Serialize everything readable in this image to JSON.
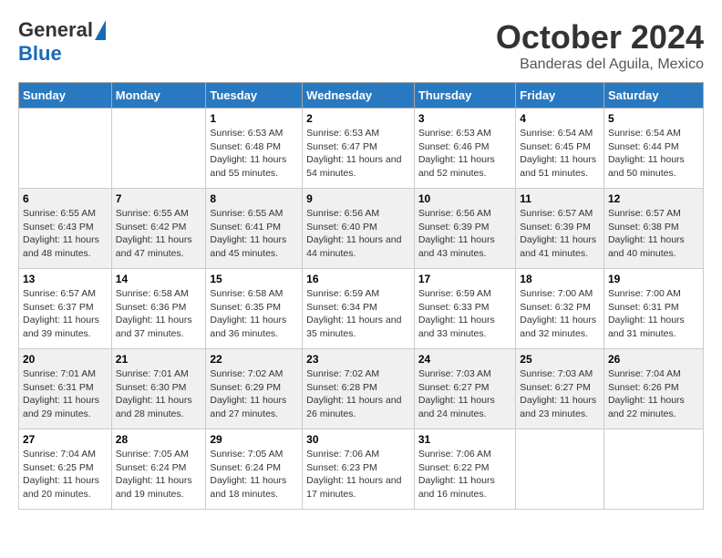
{
  "logo": {
    "general": "General",
    "blue": "Blue"
  },
  "title": "October 2024",
  "location": "Banderas del Aguila, Mexico",
  "days_header": [
    "Sunday",
    "Monday",
    "Tuesday",
    "Wednesday",
    "Thursday",
    "Friday",
    "Saturday"
  ],
  "weeks": [
    [
      {
        "day": "",
        "info": ""
      },
      {
        "day": "",
        "info": ""
      },
      {
        "day": "1",
        "info": "Sunrise: 6:53 AM\nSunset: 6:48 PM\nDaylight: 11 hours and 55 minutes."
      },
      {
        "day": "2",
        "info": "Sunrise: 6:53 AM\nSunset: 6:47 PM\nDaylight: 11 hours and 54 minutes."
      },
      {
        "day": "3",
        "info": "Sunrise: 6:53 AM\nSunset: 6:46 PM\nDaylight: 11 hours and 52 minutes."
      },
      {
        "day": "4",
        "info": "Sunrise: 6:54 AM\nSunset: 6:45 PM\nDaylight: 11 hours and 51 minutes."
      },
      {
        "day": "5",
        "info": "Sunrise: 6:54 AM\nSunset: 6:44 PM\nDaylight: 11 hours and 50 minutes."
      }
    ],
    [
      {
        "day": "6",
        "info": "Sunrise: 6:55 AM\nSunset: 6:43 PM\nDaylight: 11 hours and 48 minutes."
      },
      {
        "day": "7",
        "info": "Sunrise: 6:55 AM\nSunset: 6:42 PM\nDaylight: 11 hours and 47 minutes."
      },
      {
        "day": "8",
        "info": "Sunrise: 6:55 AM\nSunset: 6:41 PM\nDaylight: 11 hours and 45 minutes."
      },
      {
        "day": "9",
        "info": "Sunrise: 6:56 AM\nSunset: 6:40 PM\nDaylight: 11 hours and 44 minutes."
      },
      {
        "day": "10",
        "info": "Sunrise: 6:56 AM\nSunset: 6:39 PM\nDaylight: 11 hours and 43 minutes."
      },
      {
        "day": "11",
        "info": "Sunrise: 6:57 AM\nSunset: 6:39 PM\nDaylight: 11 hours and 41 minutes."
      },
      {
        "day": "12",
        "info": "Sunrise: 6:57 AM\nSunset: 6:38 PM\nDaylight: 11 hours and 40 minutes."
      }
    ],
    [
      {
        "day": "13",
        "info": "Sunrise: 6:57 AM\nSunset: 6:37 PM\nDaylight: 11 hours and 39 minutes."
      },
      {
        "day": "14",
        "info": "Sunrise: 6:58 AM\nSunset: 6:36 PM\nDaylight: 11 hours and 37 minutes."
      },
      {
        "day": "15",
        "info": "Sunrise: 6:58 AM\nSunset: 6:35 PM\nDaylight: 11 hours and 36 minutes."
      },
      {
        "day": "16",
        "info": "Sunrise: 6:59 AM\nSunset: 6:34 PM\nDaylight: 11 hours and 35 minutes."
      },
      {
        "day": "17",
        "info": "Sunrise: 6:59 AM\nSunset: 6:33 PM\nDaylight: 11 hours and 33 minutes."
      },
      {
        "day": "18",
        "info": "Sunrise: 7:00 AM\nSunset: 6:32 PM\nDaylight: 11 hours and 32 minutes."
      },
      {
        "day": "19",
        "info": "Sunrise: 7:00 AM\nSunset: 6:31 PM\nDaylight: 11 hours and 31 minutes."
      }
    ],
    [
      {
        "day": "20",
        "info": "Sunrise: 7:01 AM\nSunset: 6:31 PM\nDaylight: 11 hours and 29 minutes."
      },
      {
        "day": "21",
        "info": "Sunrise: 7:01 AM\nSunset: 6:30 PM\nDaylight: 11 hours and 28 minutes."
      },
      {
        "day": "22",
        "info": "Sunrise: 7:02 AM\nSunset: 6:29 PM\nDaylight: 11 hours and 27 minutes."
      },
      {
        "day": "23",
        "info": "Sunrise: 7:02 AM\nSunset: 6:28 PM\nDaylight: 11 hours and 26 minutes."
      },
      {
        "day": "24",
        "info": "Sunrise: 7:03 AM\nSunset: 6:27 PM\nDaylight: 11 hours and 24 minutes."
      },
      {
        "day": "25",
        "info": "Sunrise: 7:03 AM\nSunset: 6:27 PM\nDaylight: 11 hours and 23 minutes."
      },
      {
        "day": "26",
        "info": "Sunrise: 7:04 AM\nSunset: 6:26 PM\nDaylight: 11 hours and 22 minutes."
      }
    ],
    [
      {
        "day": "27",
        "info": "Sunrise: 7:04 AM\nSunset: 6:25 PM\nDaylight: 11 hours and 20 minutes."
      },
      {
        "day": "28",
        "info": "Sunrise: 7:05 AM\nSunset: 6:24 PM\nDaylight: 11 hours and 19 minutes."
      },
      {
        "day": "29",
        "info": "Sunrise: 7:05 AM\nSunset: 6:24 PM\nDaylight: 11 hours and 18 minutes."
      },
      {
        "day": "30",
        "info": "Sunrise: 7:06 AM\nSunset: 6:23 PM\nDaylight: 11 hours and 17 minutes."
      },
      {
        "day": "31",
        "info": "Sunrise: 7:06 AM\nSunset: 6:22 PM\nDaylight: 11 hours and 16 minutes."
      },
      {
        "day": "",
        "info": ""
      },
      {
        "day": "",
        "info": ""
      }
    ]
  ]
}
